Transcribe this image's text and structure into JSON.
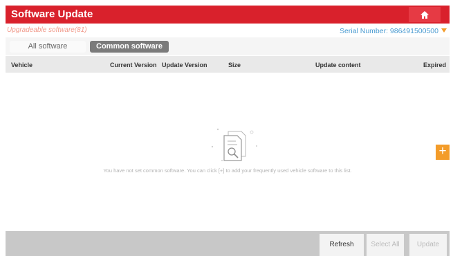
{
  "header": {
    "title": "Software Update",
    "home_icon": "home-icon"
  },
  "info": {
    "upgradeable": "Upgradeable software(81)",
    "serial_label": "Serial Number: 986491500500",
    "dropdown_icon": "chevron-down-icon"
  },
  "tabs": [
    {
      "label": "All software",
      "active": false
    },
    {
      "label": "Common software",
      "active": true
    }
  ],
  "table": {
    "columns": [
      "Vehicle",
      "Current Version",
      "Update Version",
      "Size",
      "Update content",
      "Expired"
    ]
  },
  "empty_state": {
    "message": "You have not set common software. You can click [+] to add your frequently used vehicle software to this list.",
    "icon": "empty-documents-icon"
  },
  "add_button": {
    "label": "+",
    "icon": "plus-icon"
  },
  "footer": {
    "refresh": "Refresh",
    "select_all": "Select All",
    "update": "Update"
  },
  "colors": {
    "brand": "#d9212c",
    "accent": "#f39c2a",
    "serial": "#4a9bd1",
    "upgradeable": "#f19b8c"
  }
}
